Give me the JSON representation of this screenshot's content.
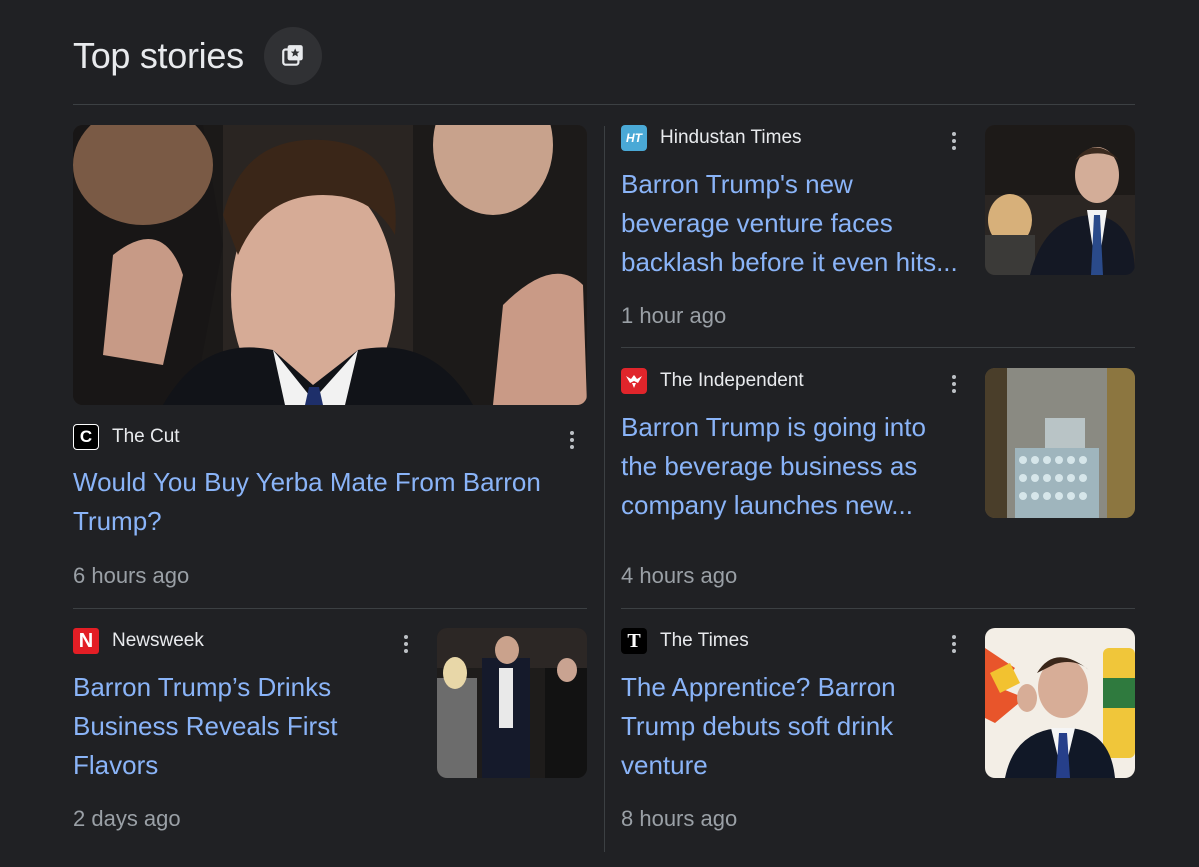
{
  "section": {
    "title": "Top stories",
    "button_icon": "stories-bookmark-icon"
  },
  "colors": {
    "background": "#202124",
    "link": "#8ab4f8",
    "muted": "#9aa0a6",
    "divider": "#3c4043"
  },
  "stories": [
    {
      "source": "The Cut",
      "favicon": "C",
      "headline": "Would You Buy Yerba Mate From Barron Trump?",
      "time": "6 hours ago"
    },
    {
      "source": "Hindustan Times",
      "favicon": "HT",
      "headline": "Barron Trump's new beverage venture faces backlash before it even hits...",
      "time": "1 hour ago"
    },
    {
      "source": "The Independent",
      "favicon": "eagle",
      "headline": "Barron Trump is going into the beverage business as company launches new...",
      "time": "4 hours ago"
    },
    {
      "source": "Newsweek",
      "favicon": "N",
      "headline": "Barron Trump’s Drinks Business Reveals First Flavors",
      "time": "2 days ago"
    },
    {
      "source": "The Times",
      "favicon": "T",
      "headline": "The Apprentice? Barron Trump debuts soft drink venture",
      "time": "8 hours ago"
    }
  ]
}
